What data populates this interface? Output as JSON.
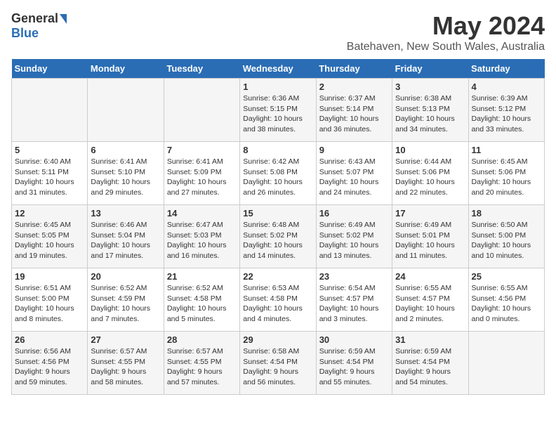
{
  "header": {
    "logo_general": "General",
    "logo_blue": "Blue",
    "month_year": "May 2024",
    "location": "Batehaven, New South Wales, Australia"
  },
  "days_of_week": [
    "Sunday",
    "Monday",
    "Tuesday",
    "Wednesday",
    "Thursday",
    "Friday",
    "Saturday"
  ],
  "weeks": [
    [
      {
        "day": "",
        "info": ""
      },
      {
        "day": "",
        "info": ""
      },
      {
        "day": "",
        "info": ""
      },
      {
        "day": "1",
        "info": "Sunrise: 6:36 AM\nSunset: 5:15 PM\nDaylight: 10 hours\nand 38 minutes."
      },
      {
        "day": "2",
        "info": "Sunrise: 6:37 AM\nSunset: 5:14 PM\nDaylight: 10 hours\nand 36 minutes."
      },
      {
        "day": "3",
        "info": "Sunrise: 6:38 AM\nSunset: 5:13 PM\nDaylight: 10 hours\nand 34 minutes."
      },
      {
        "day": "4",
        "info": "Sunrise: 6:39 AM\nSunset: 5:12 PM\nDaylight: 10 hours\nand 33 minutes."
      }
    ],
    [
      {
        "day": "5",
        "info": "Sunrise: 6:40 AM\nSunset: 5:11 PM\nDaylight: 10 hours\nand 31 minutes."
      },
      {
        "day": "6",
        "info": "Sunrise: 6:41 AM\nSunset: 5:10 PM\nDaylight: 10 hours\nand 29 minutes."
      },
      {
        "day": "7",
        "info": "Sunrise: 6:41 AM\nSunset: 5:09 PM\nDaylight: 10 hours\nand 27 minutes."
      },
      {
        "day": "8",
        "info": "Sunrise: 6:42 AM\nSunset: 5:08 PM\nDaylight: 10 hours\nand 26 minutes."
      },
      {
        "day": "9",
        "info": "Sunrise: 6:43 AM\nSunset: 5:07 PM\nDaylight: 10 hours\nand 24 minutes."
      },
      {
        "day": "10",
        "info": "Sunrise: 6:44 AM\nSunset: 5:06 PM\nDaylight: 10 hours\nand 22 minutes."
      },
      {
        "day": "11",
        "info": "Sunrise: 6:45 AM\nSunset: 5:06 PM\nDaylight: 10 hours\nand 20 minutes."
      }
    ],
    [
      {
        "day": "12",
        "info": "Sunrise: 6:45 AM\nSunset: 5:05 PM\nDaylight: 10 hours\nand 19 minutes."
      },
      {
        "day": "13",
        "info": "Sunrise: 6:46 AM\nSunset: 5:04 PM\nDaylight: 10 hours\nand 17 minutes."
      },
      {
        "day": "14",
        "info": "Sunrise: 6:47 AM\nSunset: 5:03 PM\nDaylight: 10 hours\nand 16 minutes."
      },
      {
        "day": "15",
        "info": "Sunrise: 6:48 AM\nSunset: 5:02 PM\nDaylight: 10 hours\nand 14 minutes."
      },
      {
        "day": "16",
        "info": "Sunrise: 6:49 AM\nSunset: 5:02 PM\nDaylight: 10 hours\nand 13 minutes."
      },
      {
        "day": "17",
        "info": "Sunrise: 6:49 AM\nSunset: 5:01 PM\nDaylight: 10 hours\nand 11 minutes."
      },
      {
        "day": "18",
        "info": "Sunrise: 6:50 AM\nSunset: 5:00 PM\nDaylight: 10 hours\nand 10 minutes."
      }
    ],
    [
      {
        "day": "19",
        "info": "Sunrise: 6:51 AM\nSunset: 5:00 PM\nDaylight: 10 hours\nand 8 minutes."
      },
      {
        "day": "20",
        "info": "Sunrise: 6:52 AM\nSunset: 4:59 PM\nDaylight: 10 hours\nand 7 minutes."
      },
      {
        "day": "21",
        "info": "Sunrise: 6:52 AM\nSunset: 4:58 PM\nDaylight: 10 hours\nand 5 minutes."
      },
      {
        "day": "22",
        "info": "Sunrise: 6:53 AM\nSunset: 4:58 PM\nDaylight: 10 hours\nand 4 minutes."
      },
      {
        "day": "23",
        "info": "Sunrise: 6:54 AM\nSunset: 4:57 PM\nDaylight: 10 hours\nand 3 minutes."
      },
      {
        "day": "24",
        "info": "Sunrise: 6:55 AM\nSunset: 4:57 PM\nDaylight: 10 hours\nand 2 minutes."
      },
      {
        "day": "25",
        "info": "Sunrise: 6:55 AM\nSunset: 4:56 PM\nDaylight: 10 hours\nand 0 minutes."
      }
    ],
    [
      {
        "day": "26",
        "info": "Sunrise: 6:56 AM\nSunset: 4:56 PM\nDaylight: 9 hours\nand 59 minutes."
      },
      {
        "day": "27",
        "info": "Sunrise: 6:57 AM\nSunset: 4:55 PM\nDaylight: 9 hours\nand 58 minutes."
      },
      {
        "day": "28",
        "info": "Sunrise: 6:57 AM\nSunset: 4:55 PM\nDaylight: 9 hours\nand 57 minutes."
      },
      {
        "day": "29",
        "info": "Sunrise: 6:58 AM\nSunset: 4:54 PM\nDaylight: 9 hours\nand 56 minutes."
      },
      {
        "day": "30",
        "info": "Sunrise: 6:59 AM\nSunset: 4:54 PM\nDaylight: 9 hours\nand 55 minutes."
      },
      {
        "day": "31",
        "info": "Sunrise: 6:59 AM\nSunset: 4:54 PM\nDaylight: 9 hours\nand 54 minutes."
      },
      {
        "day": "",
        "info": ""
      }
    ]
  ]
}
